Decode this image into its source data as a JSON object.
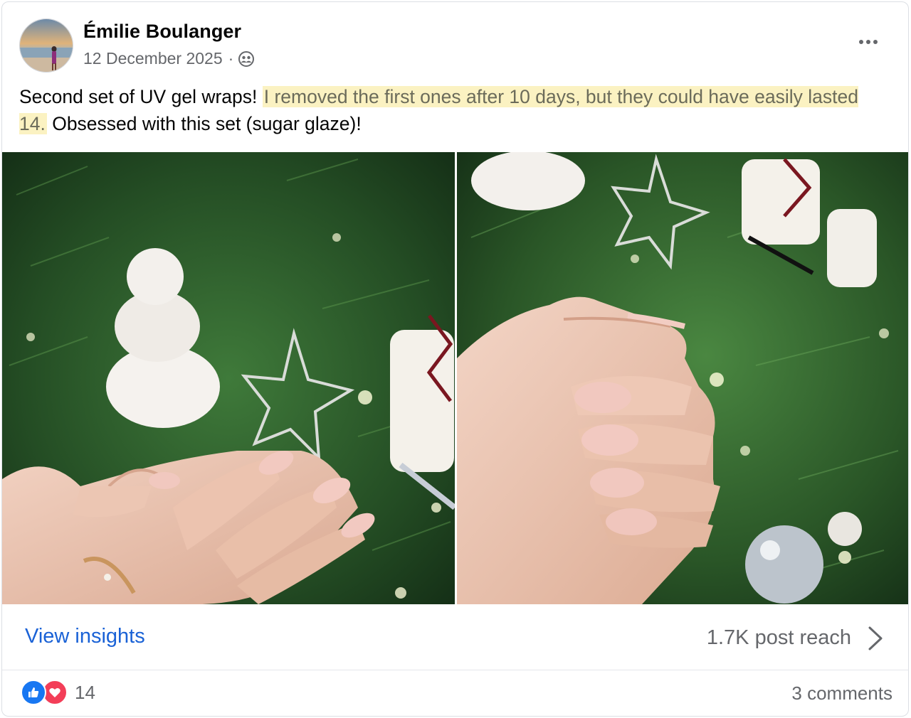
{
  "post": {
    "author": "Émilie Boulanger",
    "date": "12 December 2025",
    "meta_separator": "·",
    "audience_icon": "friends-icon",
    "caption": {
      "part1": "Second set of UV gel wraps! ",
      "highlighted": "I removed the first ones after 10 days, but they could have easily lasted 14.",
      "part2": " Obsessed with this set (sugar glaze)!"
    },
    "photos": [
      {
        "subject": "left-hand-nails-photo"
      },
      {
        "subject": "curled-hand-nails-photo"
      }
    ]
  },
  "insights": {
    "link_label": "View insights",
    "reach": "1.7K post reach"
  },
  "engagement": {
    "reaction_icons": [
      "like-icon",
      "love-icon"
    ],
    "reaction_count": "14",
    "comments": "3 comments"
  },
  "colors": {
    "link_blue": "#1a62d6",
    "highlight": "#fbf2c2",
    "like": "#1877f2",
    "love": "#f33e58",
    "secondary_text": "#65676b"
  }
}
